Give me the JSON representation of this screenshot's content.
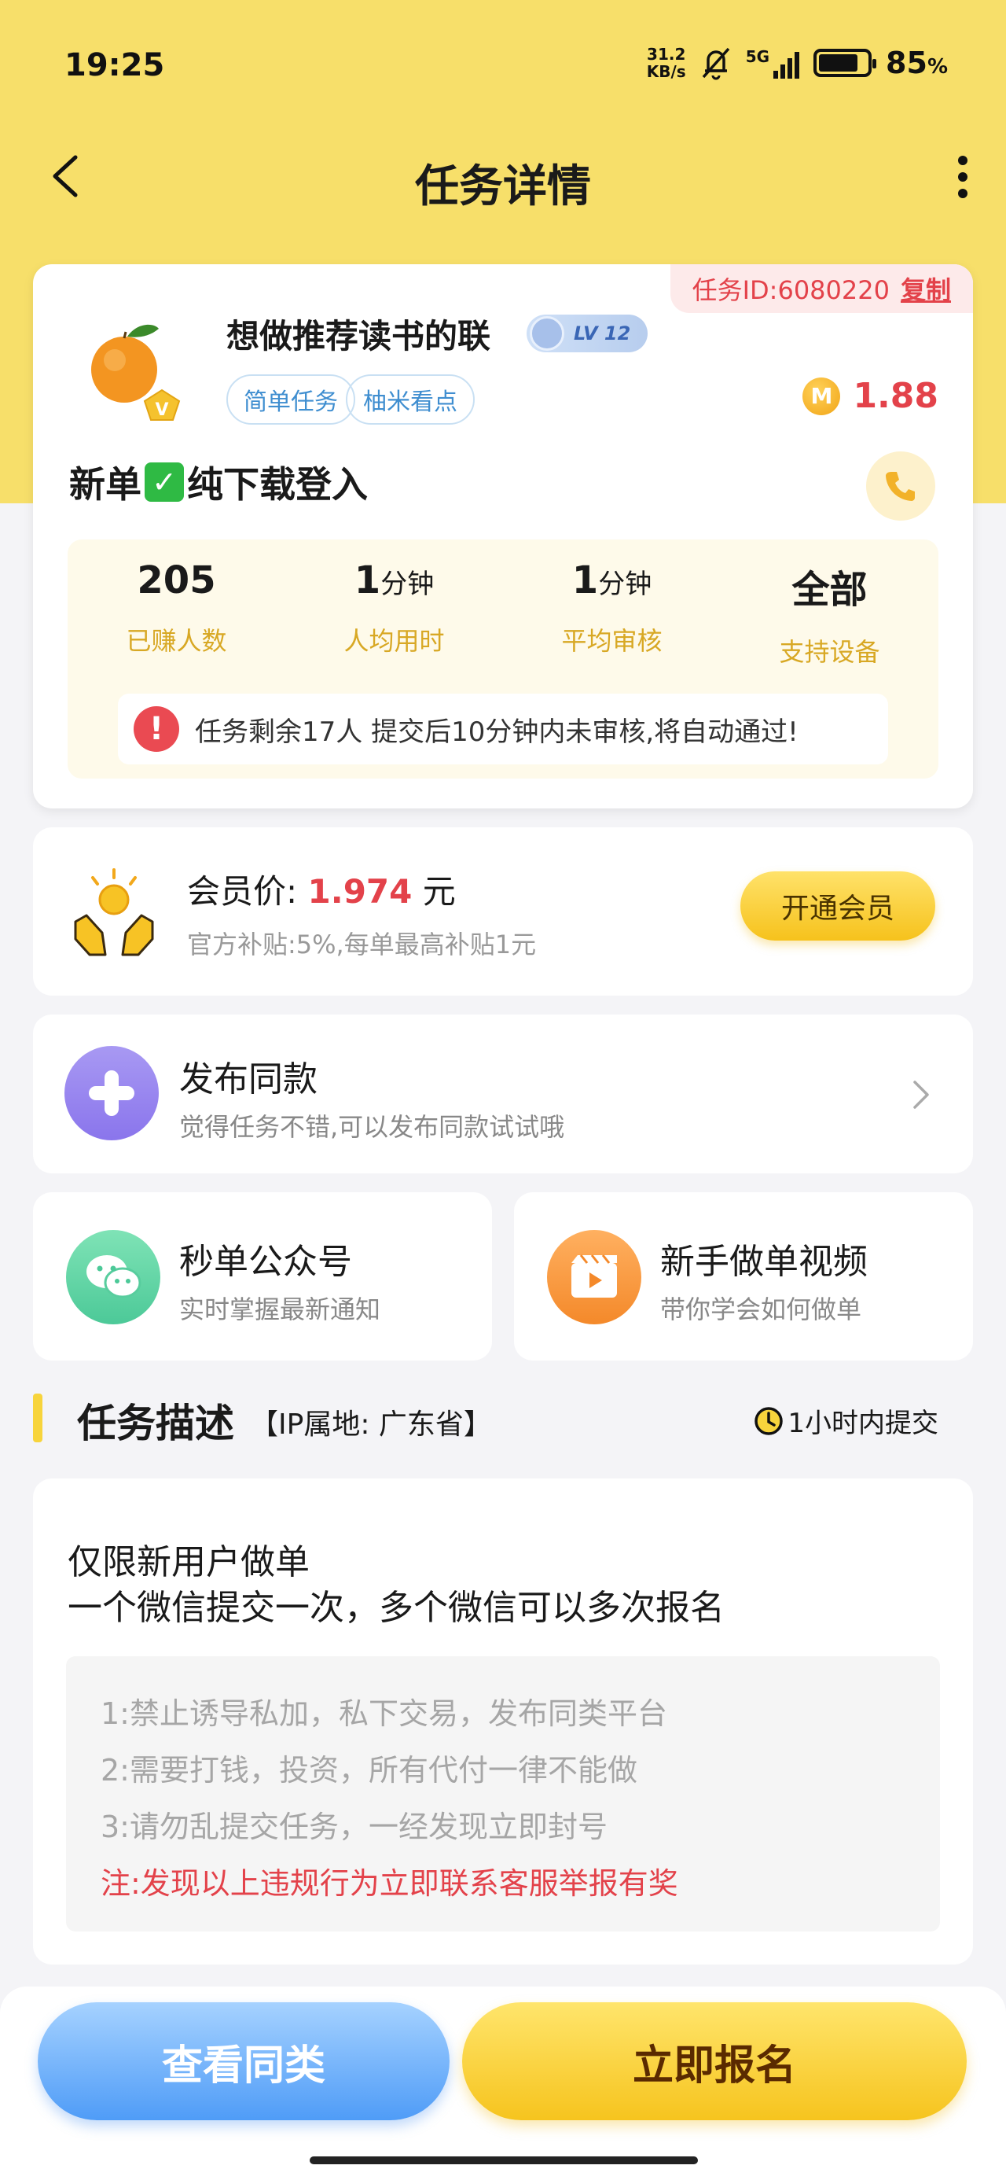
{
  "status_bar": {
    "time": "19:25",
    "net_speed_value": "31.2",
    "net_speed_unit": "KB/s",
    "network": "5G",
    "battery": "85",
    "battery_unit": "%"
  },
  "header": {
    "title": "任务详情"
  },
  "task": {
    "id_label": "任务ID:6080220",
    "copy_label": "复制",
    "publisher": "想做推荐读书的联",
    "level": "LV 12",
    "tags": [
      "简单任务",
      "柚米看点"
    ],
    "reward": "1.88",
    "coin_glyph": "M",
    "title": "新单",
    "title_rest": "纯下载登入",
    "stats": [
      {
        "value": "205",
        "unit": "",
        "label": "已赚人数"
      },
      {
        "value": "1",
        "unit": "分钟",
        "label": "人均用时"
      },
      {
        "value": "1",
        "unit": "分钟",
        "label": "平均审核"
      },
      {
        "value": "全部",
        "unit": "",
        "label": "支持设备"
      }
    ],
    "notice": "任务剩余17人  提交后10分钟内未审核,将自动通过!"
  },
  "member": {
    "title_prefix": "会员价:",
    "price": "1.974",
    "currency": "元",
    "subtitle": "官方补贴:5%,每单最高补贴1元",
    "button": "开通会员"
  },
  "publish": {
    "title": "发布同款",
    "subtitle": "觉得任务不错,可以发布同款试试哦"
  },
  "wechat": {
    "title": "秒单公众号",
    "subtitle": "实时掌握最新通知"
  },
  "video": {
    "title": "新手做单视频",
    "subtitle": "带你学会如何做单"
  },
  "description": {
    "header": "任务描述",
    "ip": "【IP属地: 广东省】",
    "deadline": "1小时内提交",
    "lines": [
      "仅限新用户做单",
      "一个微信提交一次，多个微信可以多次报名"
    ],
    "rules": [
      "1:禁止诱导私加，私下交易，发布同类平台",
      "2:需要打钱，投资，所有代付一律不能做",
      "3:请勿乱提交任务，一经发现立即封号"
    ],
    "warning": "注:发现以上违规行为立即联系客服举报有奖"
  },
  "bottom": {
    "similar": "查看同类",
    "signup": "立即报名"
  },
  "colors": {
    "brand_yellow": "#f7df6a",
    "price_red": "#e3424a",
    "stat_label": "#d8a824"
  }
}
